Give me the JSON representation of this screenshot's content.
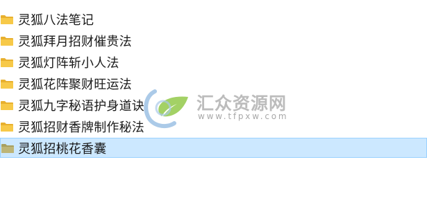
{
  "folders": [
    {
      "name": "灵狐八法笔记"
    },
    {
      "name": "灵狐拜月招财催贵法"
    },
    {
      "name": "灵狐灯阵斩小人法"
    },
    {
      "name": "灵狐花阵聚财旺运法"
    },
    {
      "name": "灵狐九字秘语护身道诀"
    },
    {
      "name": "灵狐招财香牌制作秘法"
    },
    {
      "name": "灵狐招桃花香囊"
    }
  ],
  "selected_index": 6,
  "watermark": {
    "title": "汇众资源网",
    "url": "www.tfpxw.com"
  },
  "colors": {
    "folder": "#f5c445",
    "folder_dark": "#e0a820",
    "folder_selected": "#b8b070",
    "selection_bg": "#cce8ff",
    "selection_border": "#99d1ff"
  },
  "icons": {
    "folder": "folder-icon",
    "watermark_logo": "leaf-logo-icon"
  }
}
